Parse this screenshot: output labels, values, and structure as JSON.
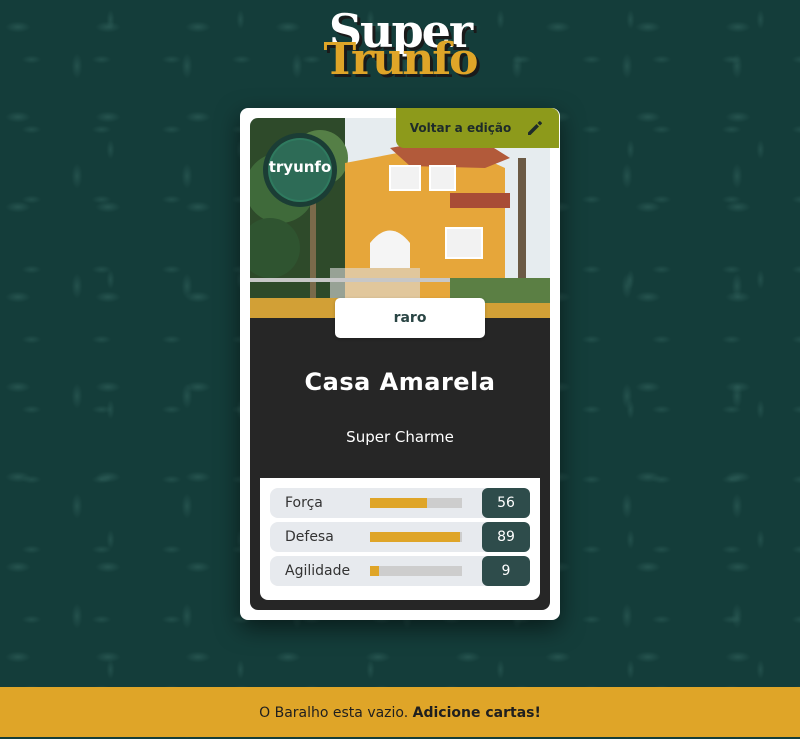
{
  "logo": {
    "line1": "Super",
    "line2": "Trunfo"
  },
  "back_button": {
    "label": "Voltar a edição",
    "icon": "pencil-icon"
  },
  "card": {
    "badge_text": "tryunfo",
    "rarity": "raro",
    "name": "Casa Amarela",
    "description": "Super Charme",
    "attributes": [
      {
        "label": "Força",
        "value": "56",
        "fraction": 0.62
      },
      {
        "label": "Defesa",
        "value": "89",
        "fraction": 0.98
      },
      {
        "label": "Agilidade",
        "value": "9",
        "fraction": 0.1
      }
    ]
  },
  "footer": {
    "text": "O Baralho esta vazio.",
    "link": "Adicione cartas!"
  },
  "colors": {
    "accent": "#dfa528",
    "dark_teal": "#2e4c4b",
    "olive": "#8d9a1b"
  }
}
